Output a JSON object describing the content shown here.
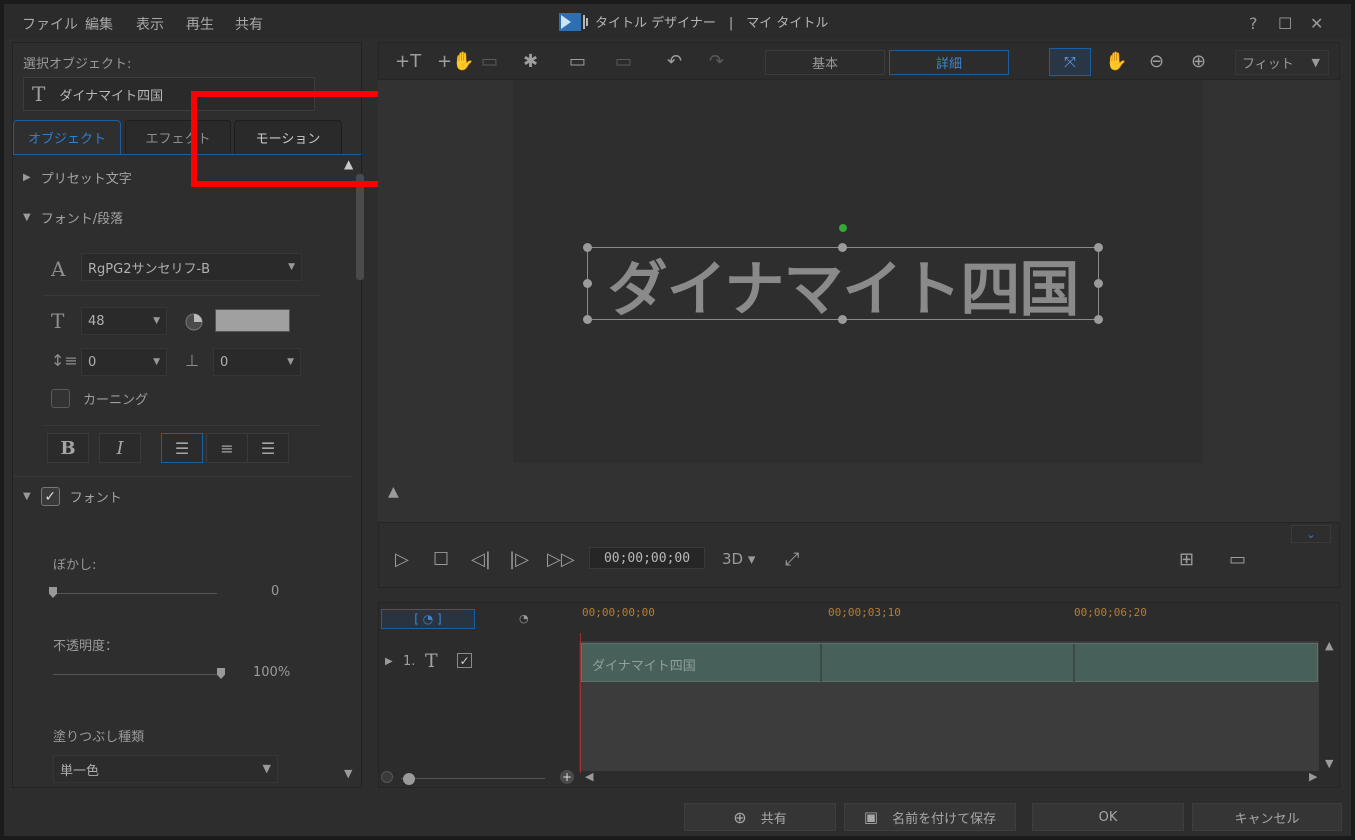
{
  "titlebar": {
    "menus": [
      "ファイル",
      "編集",
      "表示",
      "再生",
      "共有"
    ],
    "app_title": "タイトル デザイナー　|　マイ タイトル",
    "help": "?",
    "maximize": "☐",
    "close": "✕"
  },
  "left_panel": {
    "selected_object_label": "選択オブジェクト:",
    "selected_object_value": "ダイナマイト四国",
    "tabs": [
      "オブジェクト",
      "エフェクト",
      "モーション"
    ],
    "active_tab": "オブジェクト",
    "sections": {
      "preset": "プリセット文字",
      "font_paragraph": "フォント/段落",
      "font": "フォント"
    },
    "font_name": "RgPG2サンセリフ-B",
    "font_size": "48",
    "line_spacing": "0",
    "char_spacing": "0",
    "kerning_label": "カーニング",
    "kerning_checked": false,
    "bold_label": "B",
    "italic_label": "I",
    "font_enabled": true,
    "blur_label": "ぼかし:",
    "blur_value": "0",
    "blur_level_percent": 0,
    "opacity_label": "不透明度：",
    "opacity_value": "100%",
    "opacity_level_percent": 100,
    "fill_type_label": "塗りつぶし種類",
    "fill_type_value": "単一色",
    "text_color": "#a0a0a0"
  },
  "toolbar": {
    "mode_basic": "基本",
    "mode_advanced": "詳細",
    "active_mode": "詳細",
    "zoom_select": "フィット"
  },
  "preview": {
    "title_text": "ダイナマイト四国"
  },
  "playback": {
    "timecode": "00;00;00;00",
    "mode_3d": "3D"
  },
  "timeline": {
    "ruler_marks": [
      "00;00;00;00",
      "00;00;03;10",
      "00;00;06;20"
    ],
    "track_number": "1.",
    "track_checked": true,
    "clip_label": "ダイナマイト四国"
  },
  "footer": {
    "share": "共有",
    "save_as": "名前を付けて保存",
    "ok": "OK",
    "cancel": "キャンセル"
  },
  "colors": {
    "accent_blue": "#1b5f9e",
    "highlight_red": "#ff0000",
    "timecode_orange": "#b87d2f",
    "clip_green": "#47605a"
  }
}
